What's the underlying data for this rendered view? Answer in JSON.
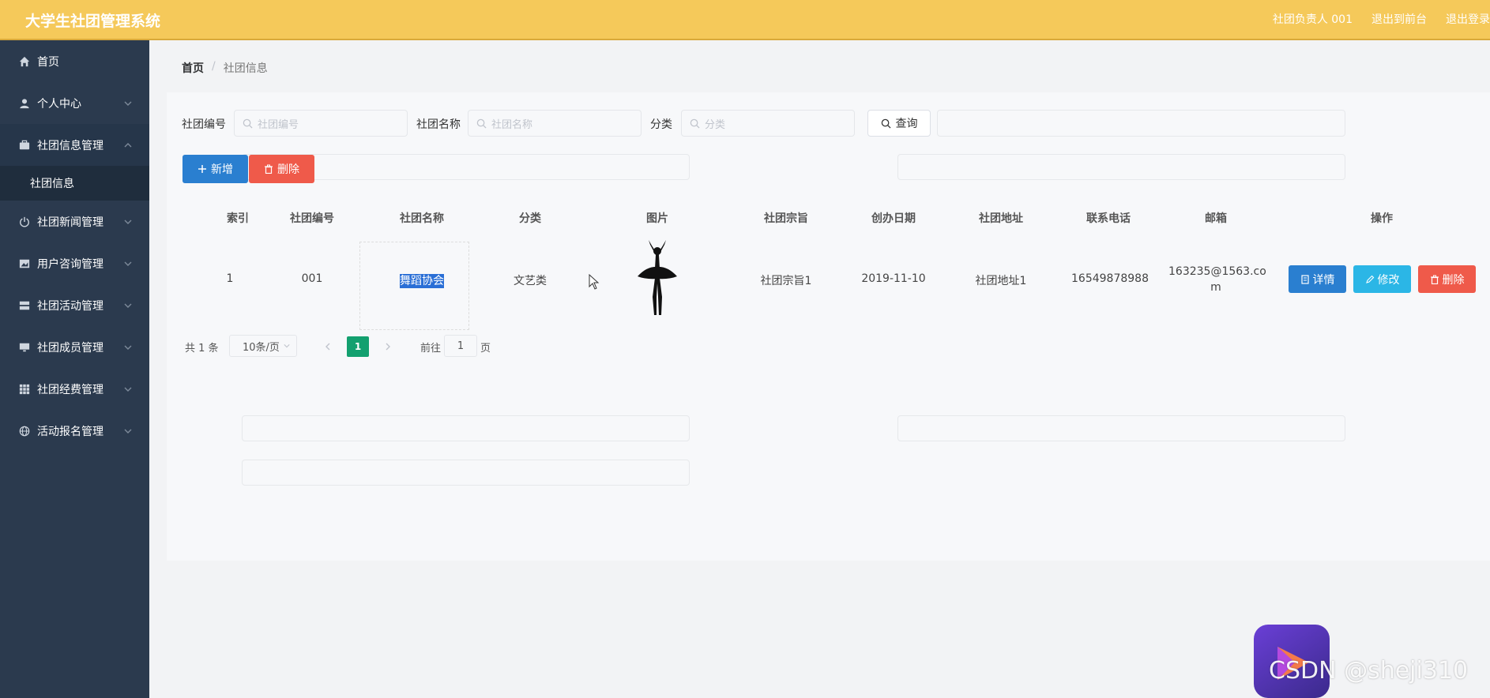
{
  "header": {
    "app_title": "大学生社团管理系统",
    "user_label": "社团负责人 001",
    "back_to_front": "退出到前台",
    "logout": "退出登录"
  },
  "sidebar": {
    "items": [
      {
        "label": "首页",
        "icon": "home-icon"
      },
      {
        "label": "个人中心",
        "icon": "user-icon"
      },
      {
        "label": "社团信息管理",
        "icon": "briefcase-icon"
      },
      {
        "label": "社团新闻管理",
        "icon": "power-icon"
      },
      {
        "label": "用户咨询管理",
        "icon": "image-icon"
      },
      {
        "label": "社团活动管理",
        "icon": "server-icon"
      },
      {
        "label": "社团成员管理",
        "icon": "monitor-icon"
      },
      {
        "label": "社团经费管理",
        "icon": "grid-icon"
      },
      {
        "label": "活动报名管理",
        "icon": "globe-icon"
      }
    ],
    "sub_item": "社团信息"
  },
  "breadcrumb": {
    "home": "首页",
    "separator": "/",
    "current": "社团信息"
  },
  "search": {
    "code_label": "社团编号",
    "code_placeholder": "社团编号",
    "name_label": "社团名称",
    "name_placeholder": "社团名称",
    "category_label": "分类",
    "category_placeholder": "分类",
    "query_button": "查询"
  },
  "actions": {
    "add": "新增",
    "delete": "删除"
  },
  "table": {
    "headers": [
      "索引",
      "社团编号",
      "社团名称",
      "分类",
      "图片",
      "社团宗旨",
      "创办日期",
      "社团地址",
      "联系电话",
      "邮箱",
      "操作"
    ],
    "rows": [
      {
        "index": "1",
        "code": "001",
        "name": "舞蹈协会",
        "category": "文艺类",
        "image": "dancer-silhouette",
        "purpose": "社团宗旨1",
        "date": "2019-11-10",
        "address": "社团地址1",
        "phone": "16549878988",
        "email_line1": "163235@1563.co",
        "email_line2": "m"
      }
    ],
    "row_actions": {
      "detail": "详情",
      "edit": "修改",
      "delete": "删除"
    }
  },
  "pagination": {
    "total": "共 1 条",
    "page_size": "10条/页",
    "current_page": "1",
    "goto_label": "前往",
    "goto_value": "1",
    "page_suffix": "页"
  },
  "watermark": {
    "text": "CSDN @sheji310"
  },
  "colors": {
    "header": "#f5c95a",
    "sidebar": "#2b3a4e",
    "primary": "#2a7fd0",
    "danger": "#ef5a4a",
    "info": "#2bb6e6",
    "pager_active": "#13a06f"
  }
}
